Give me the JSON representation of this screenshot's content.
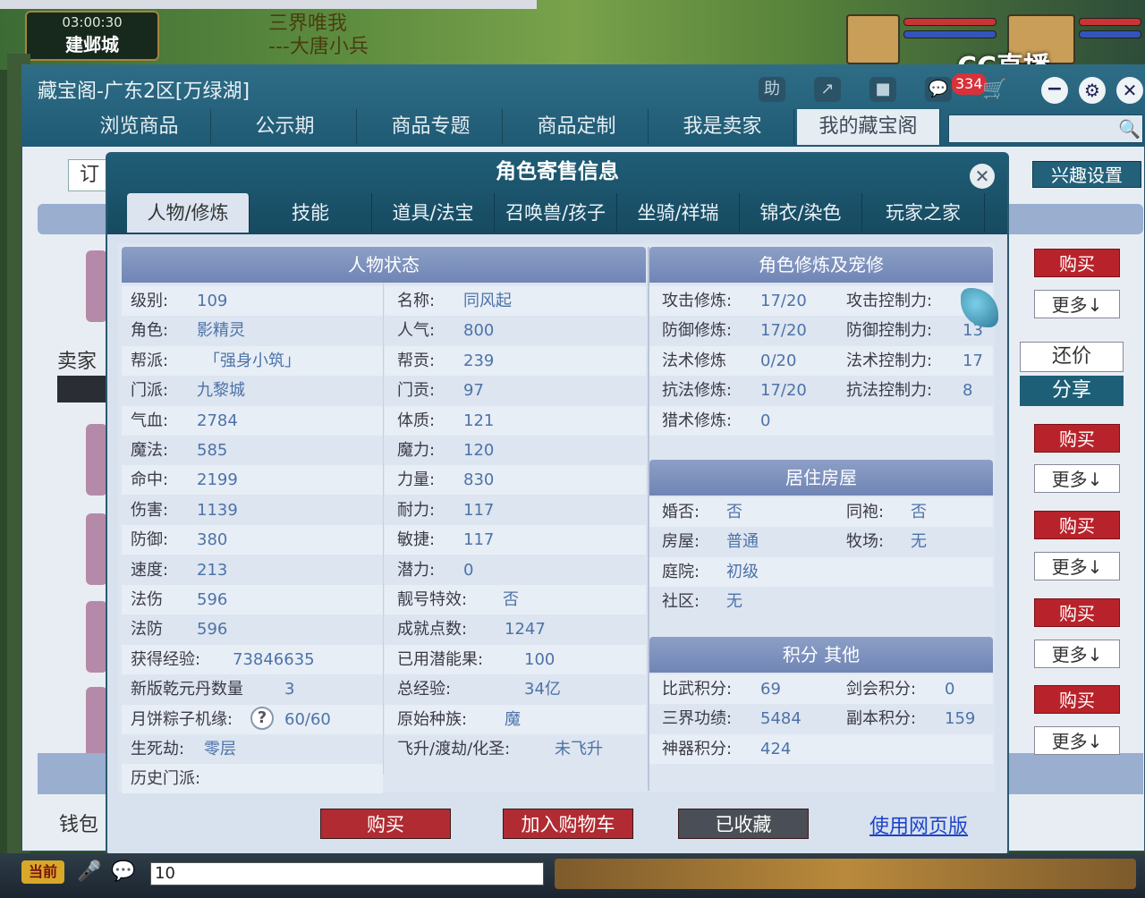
{
  "game": {
    "time": "03:00:30",
    "city": "建邺城",
    "npc_line1": "三界唯我",
    "npc_line2": "---大唐小兵",
    "chat_channel": "当前",
    "chat_input": "10",
    "stream_logo": "CC直播",
    "cart_badge": "334"
  },
  "window": {
    "title": "藏宝阁-广东2区[万绿湖]",
    "header_buttons": [
      "助",
      "↗",
      "■",
      "💬"
    ],
    "nav": [
      "浏览商品",
      "公示期",
      "商品专题",
      "商品定制",
      "我是卖家",
      "我的藏宝阁"
    ],
    "filter_label": "订",
    "interest_button": "兴趣设置",
    "seller_label": "卖家",
    "wallet_label": "钱包",
    "side": {
      "buy": "购买",
      "more": "更多↓",
      "counter": "还价",
      "share": "分享"
    }
  },
  "dialog": {
    "title": "角色寄售信息",
    "tabs": [
      "人物/修炼",
      "技能",
      "道具/法宝",
      "召唤兽/孩子",
      "坐骑/祥瑞",
      "锦衣/染色",
      "玩家之家"
    ],
    "status_title": "人物状态",
    "status_left": [
      {
        "label": "级别:",
        "value": "109"
      },
      {
        "label": "角色:",
        "value": "影精灵"
      },
      {
        "label": "帮派:",
        "value": "「强身小筑」"
      },
      {
        "label": "门派:",
        "value": "九黎城"
      },
      {
        "label": "气血:",
        "value": "2784"
      },
      {
        "label": "魔法:",
        "value": "585"
      },
      {
        "label": "命中:",
        "value": "2199"
      },
      {
        "label": "伤害:",
        "value": "1139"
      },
      {
        "label": "防御:",
        "value": "380"
      },
      {
        "label": "速度:",
        "value": "213"
      },
      {
        "label": "法伤",
        "value": "596"
      },
      {
        "label": "法防",
        "value": "596"
      },
      {
        "label": "获得经验:",
        "value": "73846635"
      },
      {
        "label": "新版乾元丹数量",
        "value": "3"
      },
      {
        "label": "月饼粽子机缘:",
        "value": "60/60"
      },
      {
        "label": "生死劫:",
        "value": "零层"
      },
      {
        "label": "历史门派:",
        "value": ""
      }
    ],
    "status_right": [
      {
        "label": "名称:",
        "value": "同风起"
      },
      {
        "label": "人气:",
        "value": "800"
      },
      {
        "label": "帮贡:",
        "value": "239"
      },
      {
        "label": "门贡:",
        "value": "97"
      },
      {
        "label": "体质:",
        "value": "121"
      },
      {
        "label": "魔力:",
        "value": "120"
      },
      {
        "label": "力量:",
        "value": "830"
      },
      {
        "label": "耐力:",
        "value": "117"
      },
      {
        "label": "敏捷:",
        "value": "117"
      },
      {
        "label": "潜力:",
        "value": "0"
      },
      {
        "label": "靓号特效:",
        "value": "否"
      },
      {
        "label": "成就点数:",
        "value": "1247"
      },
      {
        "label": "已用潜能果:",
        "value": "100"
      },
      {
        "label": "总经验:",
        "value": "34亿"
      },
      {
        "label": "原始种族:",
        "value": "魔"
      },
      {
        "label": "飞升/渡劫/化圣:",
        "value": "未飞升"
      }
    ],
    "cultivation_title": "角色修炼及宠修",
    "cultivation": [
      {
        "label": "攻击修炼:",
        "value": "17/20",
        "label2": "攻击控制力:",
        "value2": ""
      },
      {
        "label": "防御修炼:",
        "value": "17/20",
        "label2": "防御控制力:",
        "value2": "13"
      },
      {
        "label": "法术修炼",
        "value": "0/20",
        "label2": "法术控制力:",
        "value2": "17"
      },
      {
        "label": "抗法修炼:",
        "value": "17/20",
        "label2": "抗法控制力:",
        "value2": "8"
      },
      {
        "label": "猎术修炼:",
        "value": "0",
        "label2": "",
        "value2": ""
      }
    ],
    "house_title": "居住房屋",
    "house": [
      {
        "label": "婚否:",
        "value": "否",
        "label2": "同袍:",
        "value2": "否"
      },
      {
        "label": "房屋:",
        "value": "普通",
        "label2": "牧场:",
        "value2": "无"
      },
      {
        "label": "庭院:",
        "value": "初级",
        "label2": "",
        "value2": ""
      },
      {
        "label": "社区:",
        "value": "无",
        "label2": "",
        "value2": ""
      }
    ],
    "score_title": "积分 其他",
    "score": [
      {
        "label": "比武积分:",
        "value": "69",
        "label2": "剑会积分:",
        "value2": "0"
      },
      {
        "label": "三界功绩:",
        "value": "5484",
        "label2": "副本积分:",
        "value2": "159"
      },
      {
        "label": "神器积分:",
        "value": "424",
        "label2": "",
        "value2": ""
      }
    ],
    "help_icon": "?",
    "buttons": {
      "buy": "购买",
      "cart": "加入购物车",
      "fav": "已收藏",
      "web": "使用网页版"
    }
  }
}
